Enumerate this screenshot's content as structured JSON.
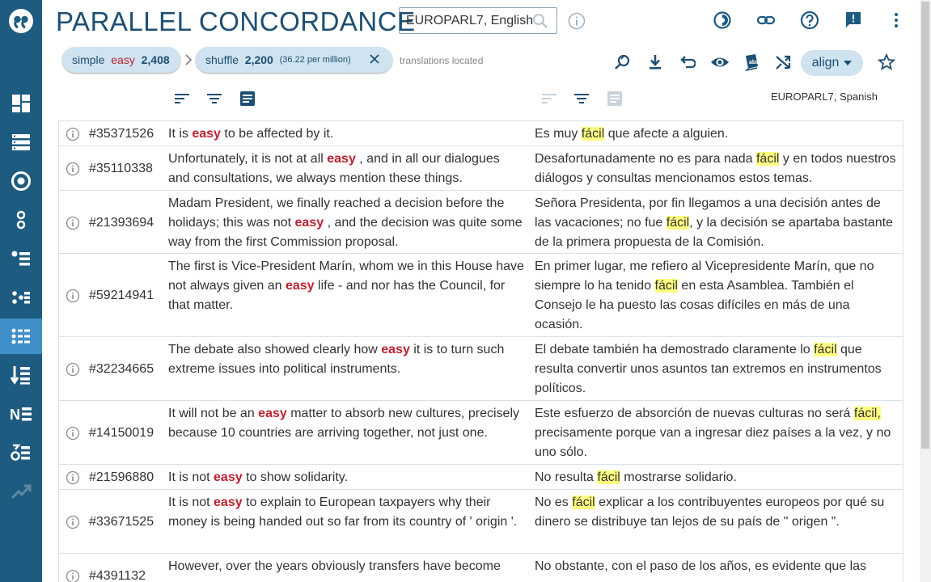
{
  "app": {
    "title": "PARALLEL CONCORDANCE",
    "corpus": "EUROPARL7, English",
    "target_corpus": "EUROPARL7, Spanish"
  },
  "breadcrumb": {
    "query_label": "simple",
    "query_keyword": "easy",
    "query_count": "2,408",
    "shuffle_label": "shuffle",
    "shuffle_count": "2,200",
    "shuffle_rate": "(36.22 per million)",
    "status": "translations located"
  },
  "toolbar": {
    "align_label": "align"
  },
  "colors": {
    "sidebar": "#1e5b80",
    "sidebar_active": "#3f8fc8",
    "accent": "#1e4f73",
    "keyword": "#c0202f",
    "highlight": "#ffff80",
    "chip": "#cfe3f0"
  },
  "sidebar": {
    "items": [
      "dashboard-icon",
      "concordance-list-icon",
      "target-icon",
      "word-sketch-icon",
      "thesaurus-icon",
      "sketch-diff-icon",
      "parallel-concordance-icon",
      "wordlist-icon",
      "ngrams-icon",
      "keywords-icon",
      "trends-icon"
    ]
  },
  "rows": [
    {
      "id": "#35371526",
      "src_before": "It is ",
      "src_kw": "easy",
      "src_after": " to be affected by it.",
      "tgt_before": "Es muy ",
      "tgt_kw": "fácil",
      "tgt_after": " que afecte a alguien."
    },
    {
      "id": "#35110338",
      "src_before": "Unfortunately, it is not at all ",
      "src_kw": "easy",
      "src_after": " , and in all our dialogues and consultations, we always mention these things.",
      "tgt_before": "Desafortunadamente no es para nada ",
      "tgt_kw": "fácil",
      "tgt_after": " y en todos nuestros diálogos y consultas mencionamos estos temas."
    },
    {
      "id": "#21393694",
      "src_before": "Madam President, we finally reached a decision before the holidays; this was not ",
      "src_kw": "easy",
      "src_after": " , and the decision was quite some way from the first Commission proposal.",
      "tgt_before": "Señora Presidenta, por fin llegamos a una decisión antes de las vacaciones; no fue ",
      "tgt_kw": "fácil",
      "tgt_after": ", y la decisión se apartaba bastante de la primera propuesta de la Comisión."
    },
    {
      "id": "#59214941",
      "src_before": "The first is Vice-President Marín, whom we in this House have not always given an ",
      "src_kw": "easy",
      "src_after": " life - and nor has the Council, for that matter.",
      "tgt_before": "En primer lugar, me refiero al Vicepresidente Marín, que no siempre lo ha tenido ",
      "tgt_kw": "fácil",
      "tgt_after": " en esta Asamblea. También el Consejo le ha puesto las cosas difíciles en más de una ocasión."
    },
    {
      "id": "#32234665",
      "src_before": "The debate also showed clearly how ",
      "src_kw": "easy",
      "src_after": " it is to turn such extreme issues into political instruments.",
      "tgt_before": "El debate también ha demostrado claramente lo ",
      "tgt_kw": "fácil",
      "tgt_after": " que resulta convertir unos asuntos tan extremos en instrumentos políticos."
    },
    {
      "id": "#14150019",
      "src_before": "It will not be an ",
      "src_kw": "easy",
      "src_after": " matter to absorb new cultures, precisely because 10 countries are arriving together, not just one.",
      "tgt_before": "Este esfuerzo de absorción de nuevas culturas no será ",
      "tgt_kw": "fácil,",
      "tgt_after": " precisamente porque van a ingresar diez países a la vez, y no uno sólo."
    },
    {
      "id": "#21596880",
      "src_before": "It is not ",
      "src_kw": "easy",
      "src_after": " to show solidarity.",
      "tgt_before": "No resulta ",
      "tgt_kw": "fácil",
      "tgt_after": " mostrarse solidario."
    },
    {
      "id": "#33671525",
      "src_before": "It is not ",
      "src_kw": "easy",
      "src_after": " to explain to European taxpayers why their money is being handed out so far from its country of ' origin '.",
      "tgt_before": "No es ",
      "tgt_kw": "fácil",
      "tgt_after": " explicar a los contribuyentes europeos por qué su dinero se distribuye tan lejos de su país de \" origen \"."
    },
    {
      "id": "#4391132",
      "src_before": "However, over the years obviously transfers have become",
      "src_kw": "",
      "src_after": "",
      "tgt_before": "No obstante, con el paso de los años, es evidente que las",
      "tgt_kw": "",
      "tgt_after": ""
    }
  ]
}
